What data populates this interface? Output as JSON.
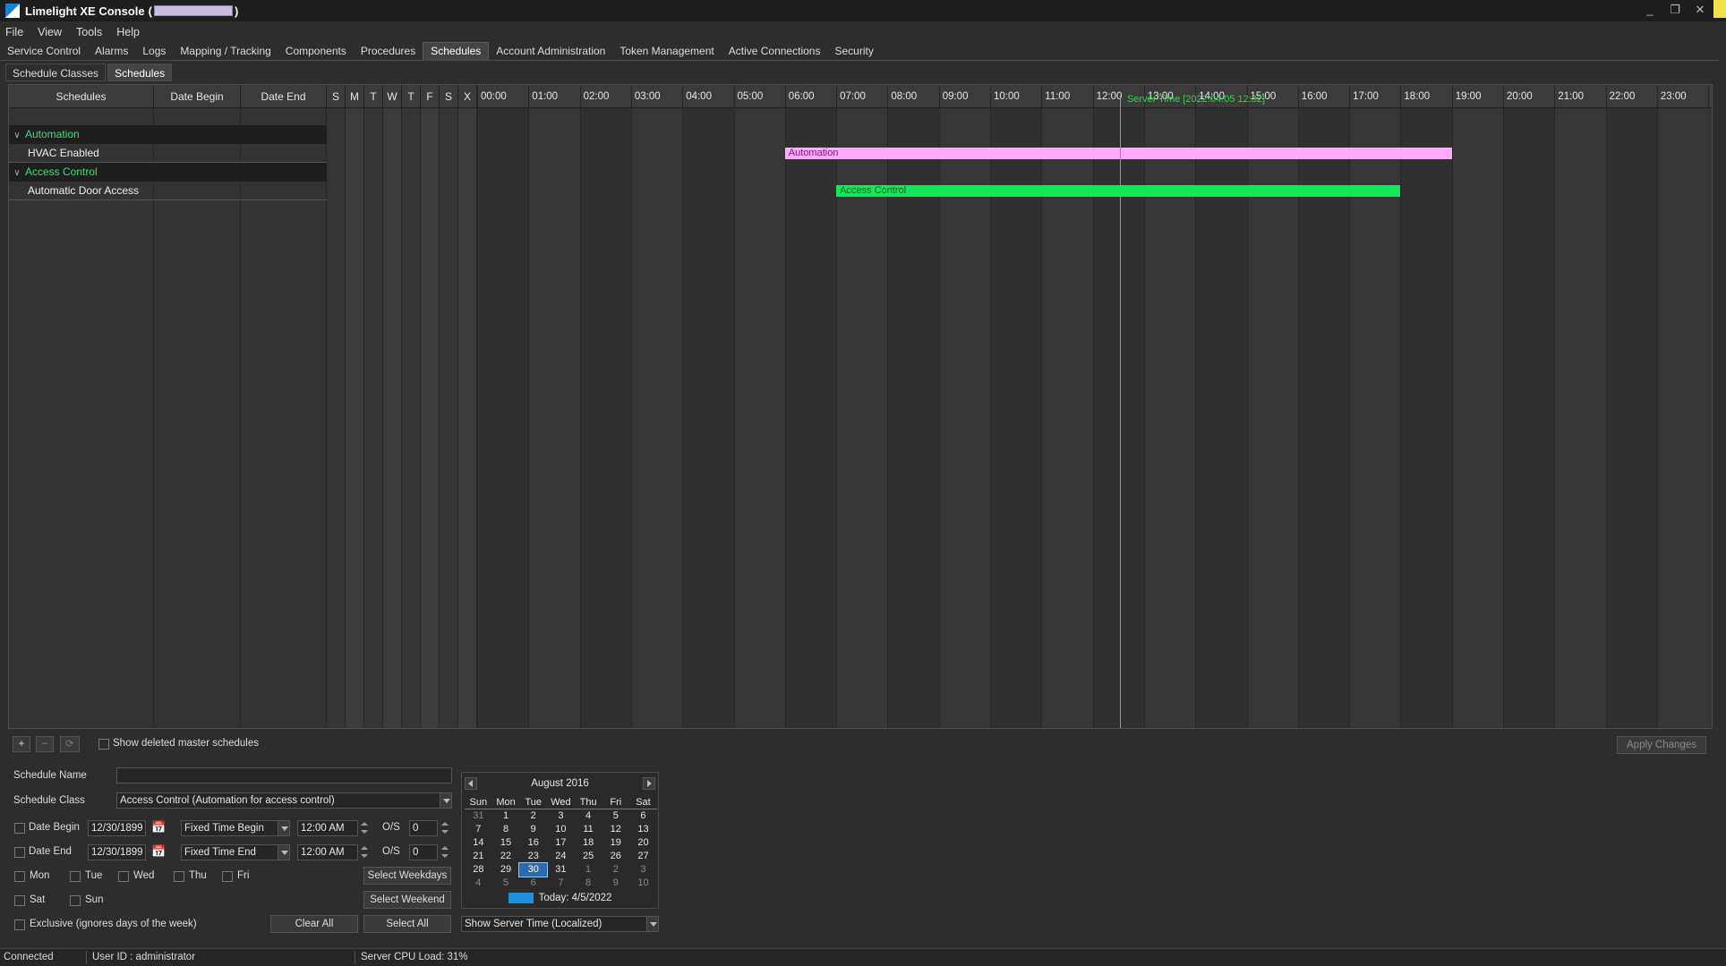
{
  "window": {
    "title": "Limelight XE Console",
    "title_open": "(",
    "title_close": ")",
    "controls": {
      "minimize": "_",
      "restore": "❐",
      "close": "✕"
    }
  },
  "menu": [
    "File",
    "View",
    "Tools",
    "Help"
  ],
  "tabs": [
    "Service Control",
    "Alarms",
    "Logs",
    "Mapping / Tracking",
    "Components",
    "Procedures",
    "Schedules",
    "Account Administration",
    "Token Management",
    "Active Connections",
    "Security"
  ],
  "active_tab": "Schedules",
  "subtabs": [
    "Schedule Classes",
    "Schedules"
  ],
  "active_subtab": "Schedules",
  "grid": {
    "headers": {
      "schedules": "Schedules",
      "date_begin": "Date Begin",
      "date_end": "Date End"
    },
    "days": [
      "S",
      "M",
      "T",
      "W",
      "T",
      "F",
      "S",
      "X"
    ],
    "hours": [
      "00:00",
      "01:00",
      "02:00",
      "03:00",
      "04:00",
      "05:00",
      "06:00",
      "07:00",
      "08:00",
      "09:00",
      "10:00",
      "11:00",
      "12:00",
      "13:00",
      "14:00",
      "15:00",
      "16:00",
      "17:00",
      "18:00",
      "19:00",
      "20:00",
      "21:00",
      "22:00",
      "23:00"
    ],
    "server_time_label": "Server Time [2022.04.05 12:32]",
    "server_time_hour": 12.53,
    "groups": [
      {
        "name": "Automation",
        "items": [
          {
            "name": "HVAC Enabled",
            "bar_label": "Automation",
            "start_hour": 6.0,
            "end_hour": 19.0,
            "color": "#ffa8ff",
            "text_color": "#7a1a7a"
          }
        ]
      },
      {
        "name": "Access Control",
        "items": [
          {
            "name": "Automatic Door Access",
            "bar_label": "Access Control",
            "start_hour": 7.0,
            "end_hour": 18.0,
            "color": "#11e85a",
            "text_color": "#0b5e2a"
          }
        ]
      }
    ]
  },
  "toolbar": {
    "add": "+",
    "remove": "−",
    "refresh": "⟳",
    "show_deleted": "Show deleted master schedules",
    "apply": "Apply Changes"
  },
  "form": {
    "schedule_name_label": "Schedule Name",
    "schedule_name_value": "",
    "schedule_class_label": "Schedule Class",
    "schedule_class_value": "Access Control (Automation for access control)",
    "date_begin_label": "Date Begin",
    "date_begin_value": "12/30/1899",
    "fixed_begin": "Fixed Time Begin",
    "time_begin": "12:00 AM",
    "date_end_label": "Date End",
    "date_end_value": "12/30/1899",
    "fixed_end": "Fixed Time End",
    "time_end": "12:00 AM",
    "os_label": "O/S",
    "os_begin": "0",
    "os_end": "0",
    "weekdays": [
      "Mon",
      "Tue",
      "Wed",
      "Thu",
      "Fri"
    ],
    "weekend": [
      "Sat",
      "Sun"
    ],
    "select_weekdays": "Select Weekdays",
    "select_weekend": "Select Weekend",
    "exclusive": "Exclusive (ignores days of the week)",
    "clear_all": "Clear All",
    "select_all": "Select All",
    "server_time_mode": "Show Server Time (Localized)"
  },
  "calendar": {
    "month": "August 2016",
    "dow": [
      "Sun",
      "Mon",
      "Tue",
      "Wed",
      "Thu",
      "Fri",
      "Sat"
    ],
    "weeks": [
      [
        "31",
        "1",
        "2",
        "3",
        "4",
        "5",
        "6"
      ],
      [
        "7",
        "8",
        "9",
        "10",
        "11",
        "12",
        "13"
      ],
      [
        "14",
        "15",
        "16",
        "17",
        "18",
        "19",
        "20"
      ],
      [
        "21",
        "22",
        "23",
        "24",
        "25",
        "26",
        "27"
      ],
      [
        "28",
        "29",
        "30",
        "31",
        "1",
        "2",
        "3"
      ],
      [
        "4",
        "5",
        "6",
        "7",
        "8",
        "9",
        "10"
      ]
    ],
    "selected": "30",
    "today": "Today: 4/5/2022"
  },
  "status": {
    "connection": "Connected",
    "user": "User ID : administrator",
    "cpu": "Server CPU Load: 31%"
  }
}
